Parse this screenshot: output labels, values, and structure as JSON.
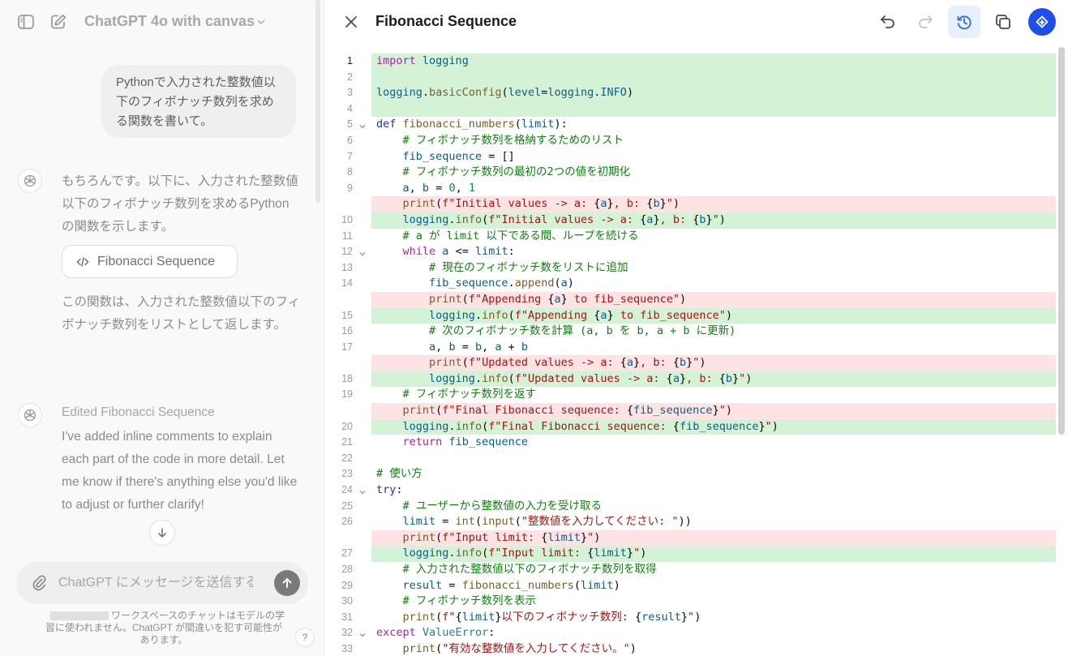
{
  "chat": {
    "model_name": "ChatGPT 4o with canvas",
    "user_message": "Pythonで入力された整数値以下のフィボナッチ数列を求める関数を書いて。",
    "assistant_message_1": "もちろんです。以下に、入力された整数値以下のフィボナッチ数列を求めるPythonの関数を示します。",
    "canvas_chip_label": "Fibonacci Sequence",
    "assistant_message_2": "この関数は、入力された整数値以下のフィボナッチ数列をリストとして返します。",
    "edited_label": "Edited Fibonacci Sequence",
    "assistant_message_3": "I've added inline comments to explain each part of the code in more detail. Let me know if there's anything else you'd like to adjust or further clarify!",
    "composer_placeholder": "ChatGPT にメッセージを送信する",
    "disclaimer": "ワークスペースのチャットはモデルの学習に使われません。ChatGPT が間違いを犯す可能性があります。",
    "help_label": "?"
  },
  "canvas": {
    "title": "Fibonacci Sequence",
    "toolbar": [
      {
        "name": "undo-icon"
      },
      {
        "name": "redo-icon"
      },
      {
        "name": "history-icon"
      },
      {
        "name": "copy-icon"
      },
      {
        "name": "review-icon"
      }
    ],
    "colors": {
      "added": "#d4f3d6",
      "removed": "#fde3e3",
      "accent": "#1f4fe8"
    },
    "code_lines": [
      {
        "ln": "1",
        "diff": "add",
        "fold": false,
        "code": "import logging"
      },
      {
        "ln": "2",
        "diff": "add",
        "fold": false,
        "code": ""
      },
      {
        "ln": "3",
        "diff": "add",
        "fold": false,
        "code": "logging.basicConfig(level=logging.INFO)"
      },
      {
        "ln": "4",
        "diff": "add",
        "fold": false,
        "code": ""
      },
      {
        "ln": "5",
        "diff": "",
        "fold": true,
        "code": "def fibonacci_numbers(limit):"
      },
      {
        "ln": "6",
        "diff": "",
        "fold": false,
        "code": "    # フィボナッチ数列を格納するためのリスト"
      },
      {
        "ln": "7",
        "diff": "",
        "fold": false,
        "code": "    fib_sequence = []"
      },
      {
        "ln": "8",
        "diff": "",
        "fold": false,
        "code": "    # フィボナッチ数列の最初の2つの値を初期化"
      },
      {
        "ln": "9",
        "diff": "",
        "fold": false,
        "code": "    a, b = 0, 1"
      },
      {
        "ln": "",
        "diff": "del",
        "fold": false,
        "code": "    print(f\"Initial values -> a: {a}, b: {b}\")"
      },
      {
        "ln": "10",
        "diff": "add",
        "fold": false,
        "code": "    logging.info(f\"Initial values -> a: {a}, b: {b}\")"
      },
      {
        "ln": "11",
        "diff": "",
        "fold": false,
        "code": "    # a が limit 以下である間、ループを続ける"
      },
      {
        "ln": "12",
        "diff": "",
        "fold": true,
        "code": "    while a <= limit:"
      },
      {
        "ln": "13",
        "diff": "",
        "fold": false,
        "code": "        # 現在のフィボナッチ数をリストに追加"
      },
      {
        "ln": "14",
        "diff": "",
        "fold": false,
        "code": "        fib_sequence.append(a)"
      },
      {
        "ln": "",
        "diff": "del",
        "fold": false,
        "code": "        print(f\"Appending {a} to fib_sequence\")"
      },
      {
        "ln": "15",
        "diff": "add",
        "fold": false,
        "code": "        logging.info(f\"Appending {a} to fib_sequence\")"
      },
      {
        "ln": "16",
        "diff": "",
        "fold": false,
        "code": "        # 次のフィボナッチ数を計算 (a, b を b, a + b に更新)"
      },
      {
        "ln": "17",
        "diff": "",
        "fold": false,
        "code": "        a, b = b, a + b"
      },
      {
        "ln": "",
        "diff": "del",
        "fold": false,
        "code": "        print(f\"Updated values -> a: {a}, b: {b}\")"
      },
      {
        "ln": "18",
        "diff": "add",
        "fold": false,
        "code": "        logging.info(f\"Updated values -> a: {a}, b: {b}\")"
      },
      {
        "ln": "19",
        "diff": "",
        "fold": false,
        "code": "    # フィボナッチ数列を返す"
      },
      {
        "ln": "",
        "diff": "del",
        "fold": false,
        "code": "    print(f\"Final Fibonacci sequence: {fib_sequence}\")"
      },
      {
        "ln": "20",
        "diff": "add",
        "fold": false,
        "code": "    logging.info(f\"Final Fibonacci sequence: {fib_sequence}\")"
      },
      {
        "ln": "21",
        "diff": "",
        "fold": false,
        "code": "    return fib_sequence"
      },
      {
        "ln": "22",
        "diff": "",
        "fold": false,
        "code": ""
      },
      {
        "ln": "23",
        "diff": "",
        "fold": false,
        "code": "# 使い方"
      },
      {
        "ln": "24",
        "diff": "",
        "fold": true,
        "code": "try:"
      },
      {
        "ln": "25",
        "diff": "",
        "fold": false,
        "code": "    # ユーザーから整数値の入力を受け取る"
      },
      {
        "ln": "26",
        "diff": "",
        "fold": false,
        "code": "    limit = int(input(\"整数値を入力してください: \"))"
      },
      {
        "ln": "",
        "diff": "del",
        "fold": false,
        "code": "    print(f\"Input limit: {limit}\")"
      },
      {
        "ln": "27",
        "diff": "add",
        "fold": false,
        "code": "    logging.info(f\"Input limit: {limit}\")"
      },
      {
        "ln": "28",
        "diff": "",
        "fold": false,
        "code": "    # 入力された整数値以下のフィボナッチ数列を取得"
      },
      {
        "ln": "29",
        "diff": "",
        "fold": false,
        "code": "    result = fibonacci_numbers(limit)"
      },
      {
        "ln": "30",
        "diff": "",
        "fold": false,
        "code": "    # フィボナッチ数列を表示"
      },
      {
        "ln": "31",
        "diff": "",
        "fold": false,
        "code": "    print(f\"{limit}以下のフィボナッチ数列: {result}\")"
      },
      {
        "ln": "32",
        "diff": "",
        "fold": true,
        "code": "except ValueError:"
      },
      {
        "ln": "33",
        "diff": "",
        "fold": false,
        "code": "    print(\"有効な整数値を入力してください。\")"
      }
    ]
  }
}
